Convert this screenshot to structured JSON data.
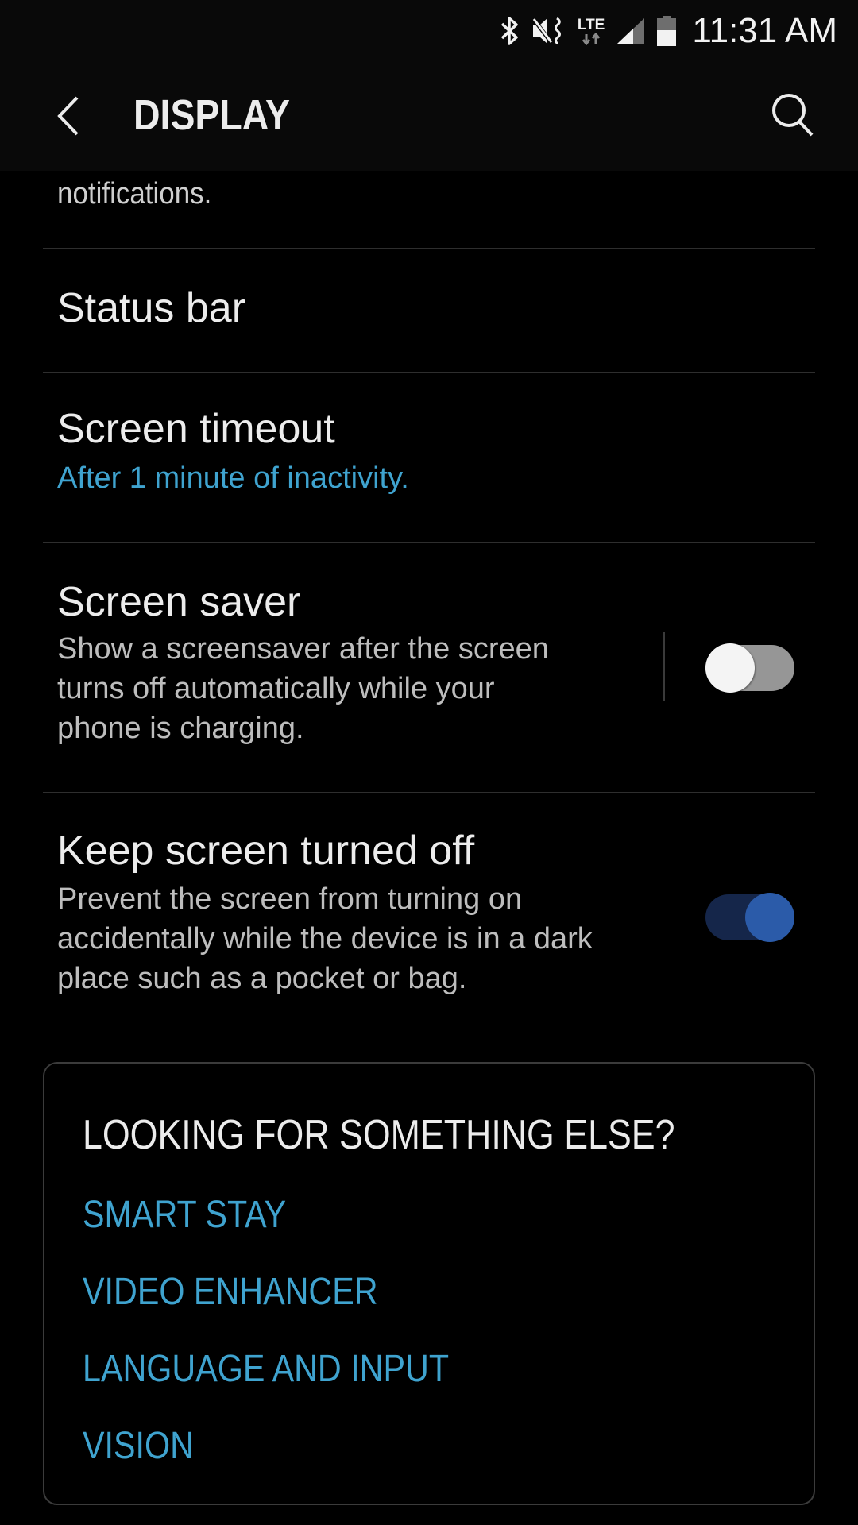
{
  "status_bar": {
    "icons": [
      "bluetooth-icon",
      "vibrate-mute-icon",
      "lte-data-icon",
      "signal-icon",
      "battery-icon"
    ],
    "lte_label": "LTE",
    "time": "11:31 AM"
  },
  "app_bar": {
    "title": "DISPLAY",
    "back_icon": "chevron-left-icon",
    "search_icon": "search-icon"
  },
  "settings": {
    "clipped_previous_text": "notifications.",
    "items": [
      {
        "title": "Status bar"
      },
      {
        "title": "Screen timeout",
        "subtitle": "After 1 minute of inactivity."
      },
      {
        "title": "Screen saver",
        "description_lines": [
          "Show a screensaver after the screen",
          "turns off automatically while your",
          "phone is charging."
        ],
        "toggle_on": false
      },
      {
        "title": "Keep screen turned off",
        "description_lines": [
          "Prevent the screen from turning on",
          "accidentally while the device is in a dark",
          "place such as a pocket or bag."
        ],
        "toggle_on": true
      }
    ]
  },
  "suggestions": {
    "heading": "LOOKING FOR SOMETHING ELSE?",
    "links": [
      "SMART STAY",
      "VIDEO ENHANCER",
      "LANGUAGE AND INPUT",
      "VISION"
    ]
  },
  "colors": {
    "accent": "#3fa3cf",
    "toggle_on_thumb": "#2b5ba9",
    "toggle_on_track": "#15264a",
    "toggle_off_track": "#969696",
    "background": "#000000",
    "header": "#090909"
  }
}
